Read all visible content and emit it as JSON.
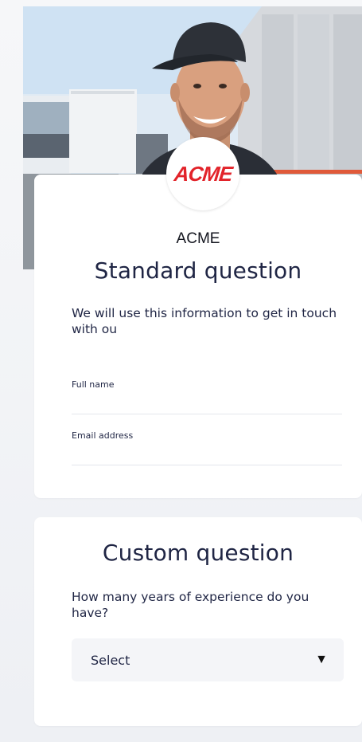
{
  "brand": {
    "logo_text": "ACME",
    "logo_color": "#e2232a",
    "company_name": "ACME"
  },
  "standard_section": {
    "title": "Standard question",
    "description": "We will use this information to get in touch with ou",
    "fields": [
      {
        "label": "Full name",
        "value": ""
      },
      {
        "label": "Email address",
        "value": ""
      }
    ]
  },
  "custom_section": {
    "title": "Custom question",
    "question": "How many years of experience do you have?",
    "select": {
      "value": "Select",
      "arrow_icon": "triangle-down-icon"
    }
  },
  "colors": {
    "heading": "#1f2544",
    "card_background": "#ffffff",
    "page_background": "#f3f4f7",
    "select_background": "#f4f5f8"
  }
}
